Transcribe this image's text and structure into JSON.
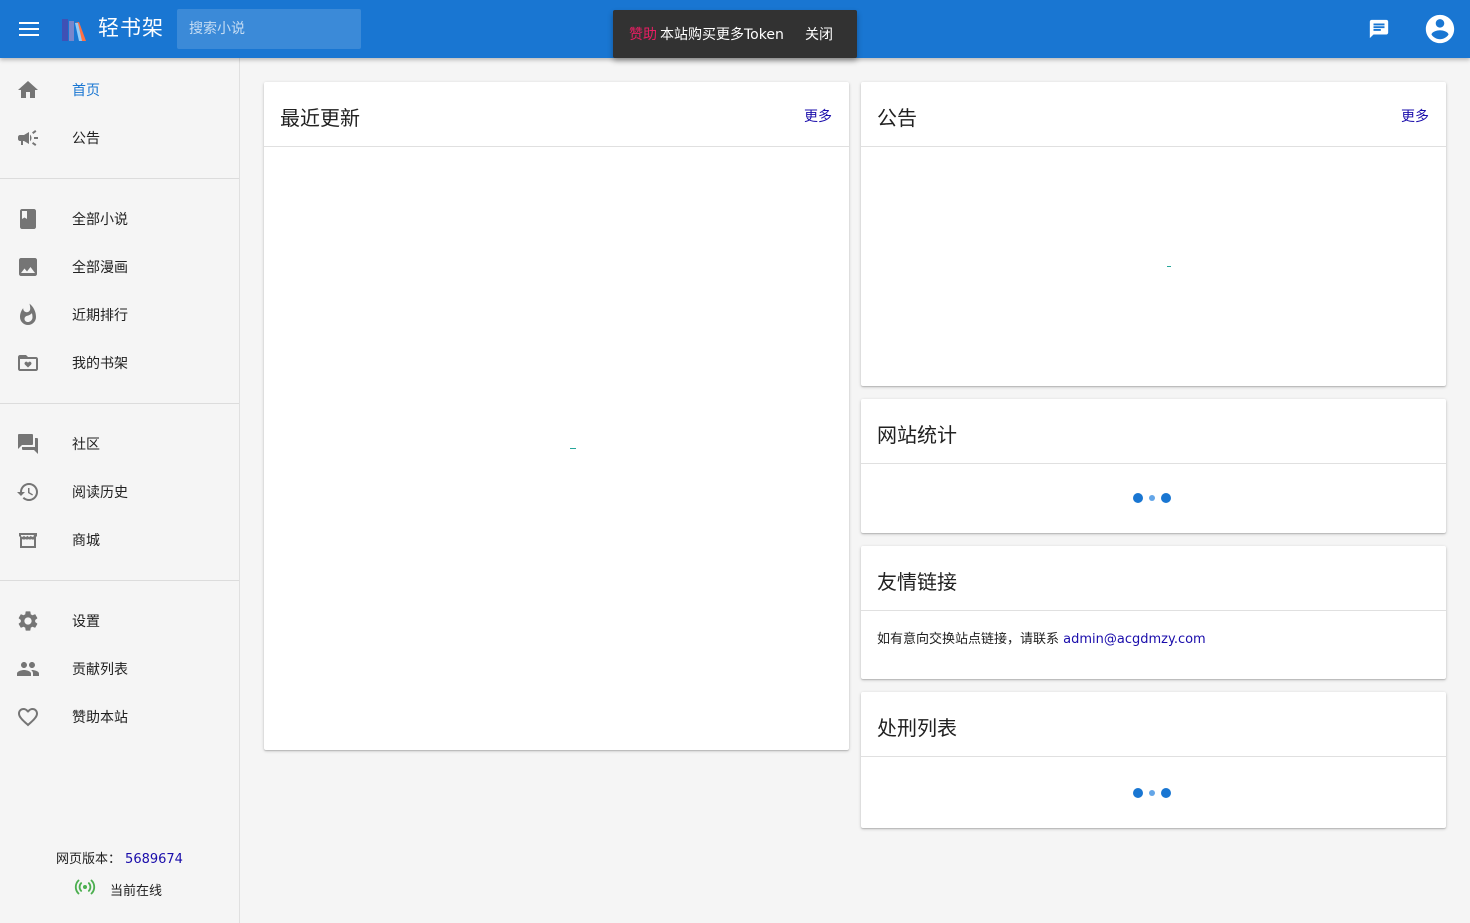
{
  "app": {
    "brand": "轻书架",
    "search_placeholder": "搜索小说"
  },
  "colors": {
    "primary": "#1976d2",
    "sponsor_accent": "#e91e63",
    "link": "#1a0dab",
    "online_green": "#4caf50"
  },
  "snackbar": {
    "sponsor_label": "赞助",
    "message": "本站购买更多Token",
    "close_label": "关闭"
  },
  "sidebar": {
    "groups": [
      [
        {
          "label": "首页",
          "icon": "home-icon",
          "active": true
        },
        {
          "label": "公告",
          "icon": "megaphone-icon"
        }
      ],
      [
        {
          "label": "全部小说",
          "icon": "book-icon"
        },
        {
          "label": "全部漫画",
          "icon": "image-icon"
        },
        {
          "label": "近期排行",
          "icon": "fire-icon"
        },
        {
          "label": "我的书架",
          "icon": "folder-heart-icon"
        }
      ],
      [
        {
          "label": "社区",
          "icon": "forum-icon"
        },
        {
          "label": "阅读历史",
          "icon": "history-icon"
        },
        {
          "label": "商城",
          "icon": "store-icon"
        }
      ],
      [
        {
          "label": "设置",
          "icon": "gear-icon"
        },
        {
          "label": "贡献列表",
          "icon": "people-icon"
        },
        {
          "label": "赞助本站",
          "icon": "heart-icon"
        }
      ]
    ],
    "version_label": "网页版本：",
    "version_number": "5689674",
    "online_label": "当前在线"
  },
  "main": {
    "recent": {
      "title": "最近更新",
      "more": "更多"
    },
    "announcements": {
      "title": "公告",
      "more": "更多"
    },
    "stats": {
      "title": "网站统计"
    },
    "links": {
      "title": "友情链接",
      "text": "如有意向交换站点链接，请联系 ",
      "email": "admin@acgdmzy.com"
    },
    "penalties": {
      "title": "处刑列表"
    }
  }
}
